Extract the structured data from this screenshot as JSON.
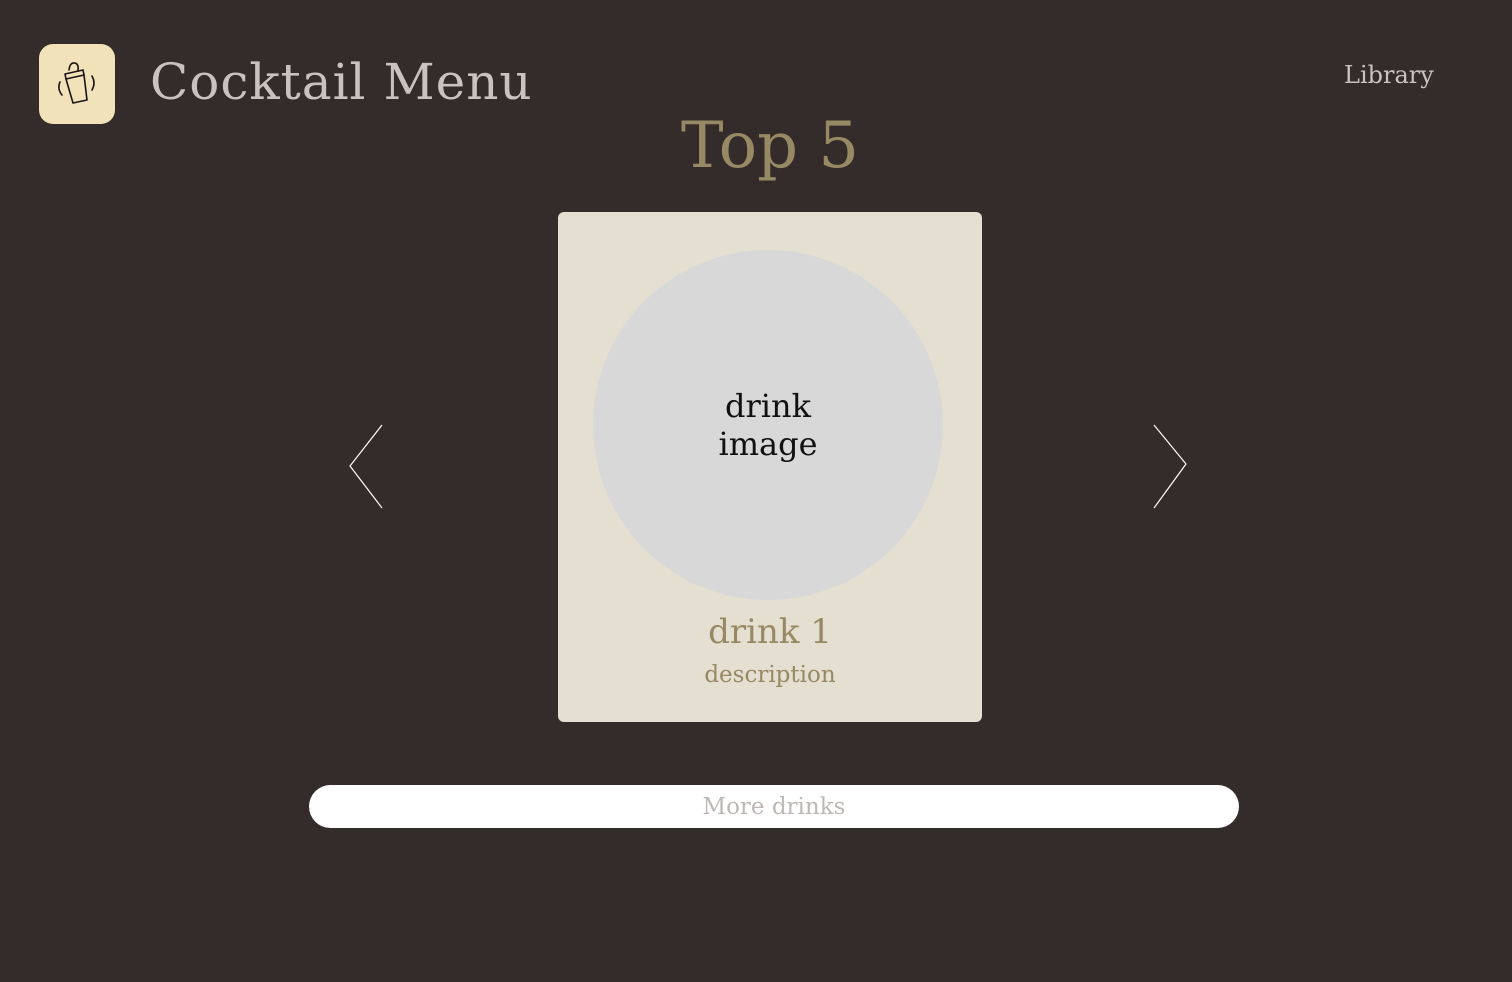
{
  "header": {
    "logo_icon": "cocktail-shaker-icon",
    "title": "Cocktail Menu",
    "nav_library": "Library"
  },
  "main": {
    "section_title": "Top 5",
    "card": {
      "image_placeholder": "drink\nimage",
      "name": "drink 1",
      "description": "description"
    },
    "prev_icon": "chevron-left-icon",
    "next_icon": "chevron-right-icon",
    "more_button": "More drinks"
  },
  "colors": {
    "background": "#342b2b",
    "logo_tile": "#f1e2ba",
    "card_bg": "#e5dfd1",
    "image_circle": "#d8d8d8",
    "accent_gold": "#968963",
    "header_text": "#c9c3c0",
    "button_bg": "#ffffff",
    "button_text": "#bdb8b6"
  }
}
